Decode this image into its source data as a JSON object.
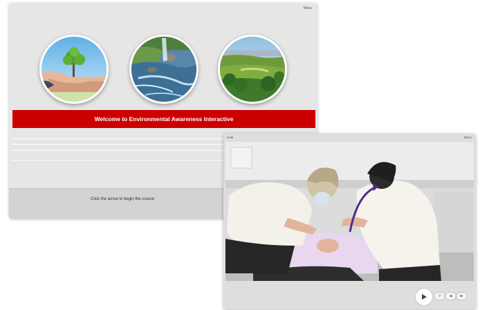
{
  "back_window": {
    "menu_label": "Menu",
    "banner_text": "Welcome to Environmental Awareness Interactive",
    "instruction_text": "Click the arrow to begin the course"
  },
  "front_window": {
    "help_label": "Help",
    "menu_label": "Menu"
  },
  "icons": {
    "play": "play-icon",
    "replay": "replay-icon",
    "back": "back-arrow-icon",
    "forward": "forward-arrow-icon"
  },
  "colors": {
    "banner": "#cc0000",
    "window_bg": "#e6e6e6",
    "footer_bg": "#d3d3d3",
    "video_arrow": "#4a2d8f"
  }
}
